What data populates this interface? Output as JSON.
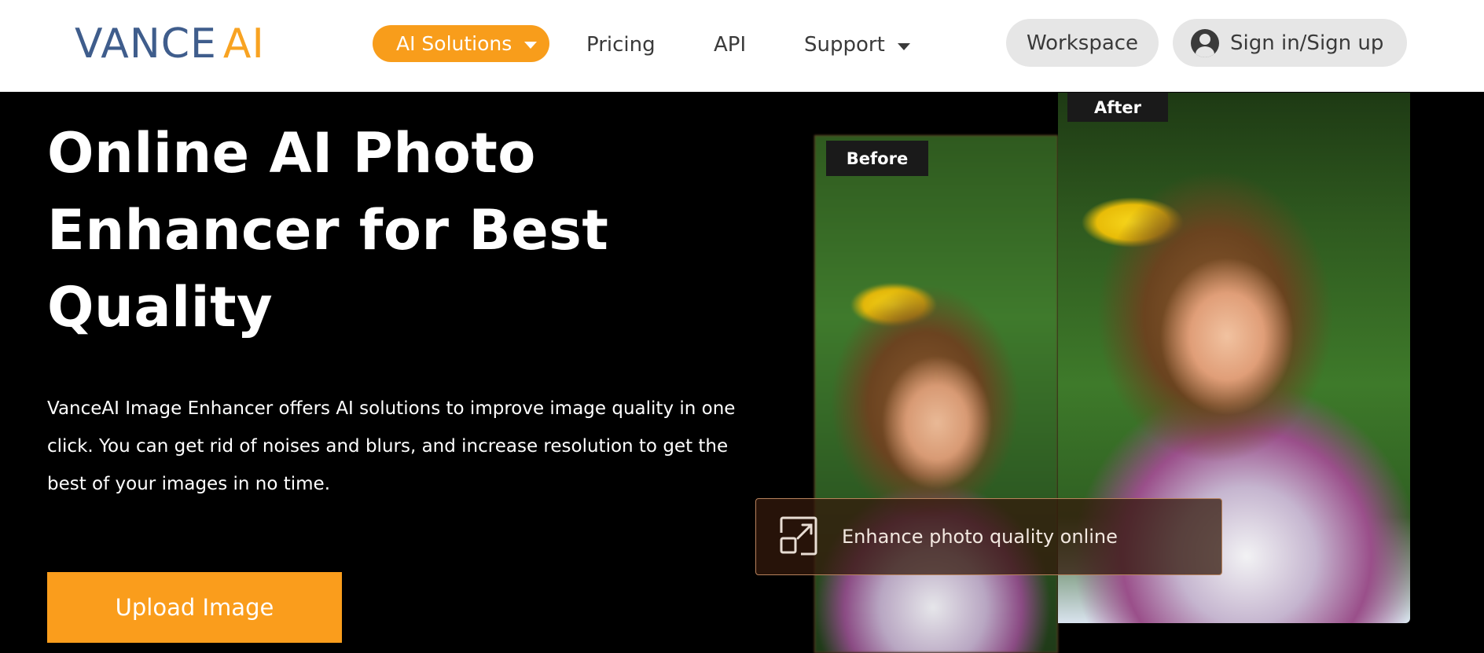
{
  "header": {
    "logo": {
      "left": "VANCE",
      "right": "AI"
    },
    "nav": {
      "ai_solutions": "AI Solutions",
      "pricing": "Pricing",
      "api": "API",
      "support": "Support"
    },
    "workspace": "Workspace",
    "signin": "Sign in/Sign up"
  },
  "hero": {
    "title": "Online AI Photo Enhancer for Best Quality",
    "description": "VanceAI Image Enhancer offers AI solutions to improve image quality in one click. You can get rid of noises and blurs, and increase resolution to get the best of your images in no time.",
    "upload_button": "Upload Image",
    "before_label": "Before",
    "after_label": "After",
    "enhance_text": "Enhance photo quality online"
  },
  "colors": {
    "brand_orange": "#f89d1b",
    "brand_blue": "#3f5d8c",
    "hero_background": "#000000"
  },
  "icons": {
    "chevron": "caret-down-icon",
    "user": "user-icon",
    "enhance": "expand-arrow-icon"
  }
}
